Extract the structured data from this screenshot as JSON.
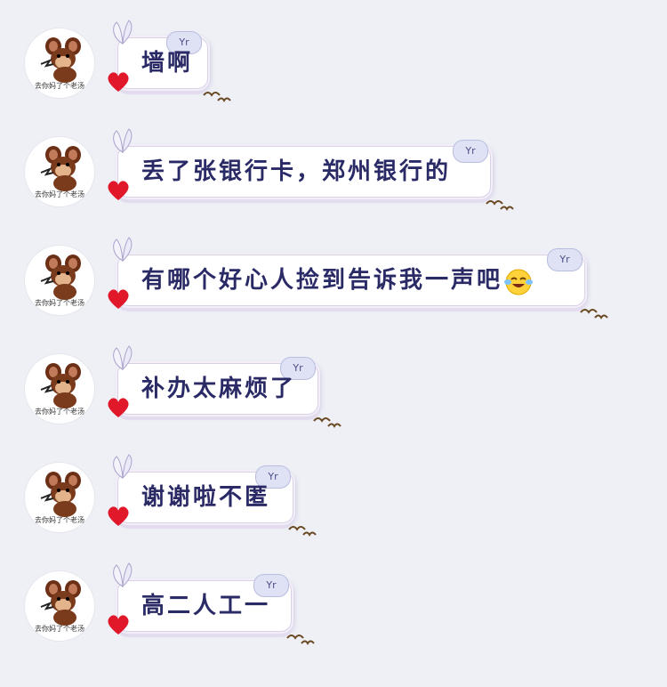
{
  "avatar": {
    "caption": "去你妈了个老汤"
  },
  "badge_label": "Yr",
  "messages": [
    {
      "text": "墙啊"
    },
    {
      "text": "丢了张银行卡，郑州银行的"
    },
    {
      "text": "有哪个好心人捡到告诉我一声吧",
      "emoji": "tears-of-joy-emoji"
    },
    {
      "text": "补办太麻烦了"
    },
    {
      "text": "谢谢啦不匿"
    },
    {
      "text": "高二人工一"
    }
  ],
  "colors": {
    "text": "#2a2a66",
    "background": "#eef0f6",
    "heart": "#e0182a"
  }
}
